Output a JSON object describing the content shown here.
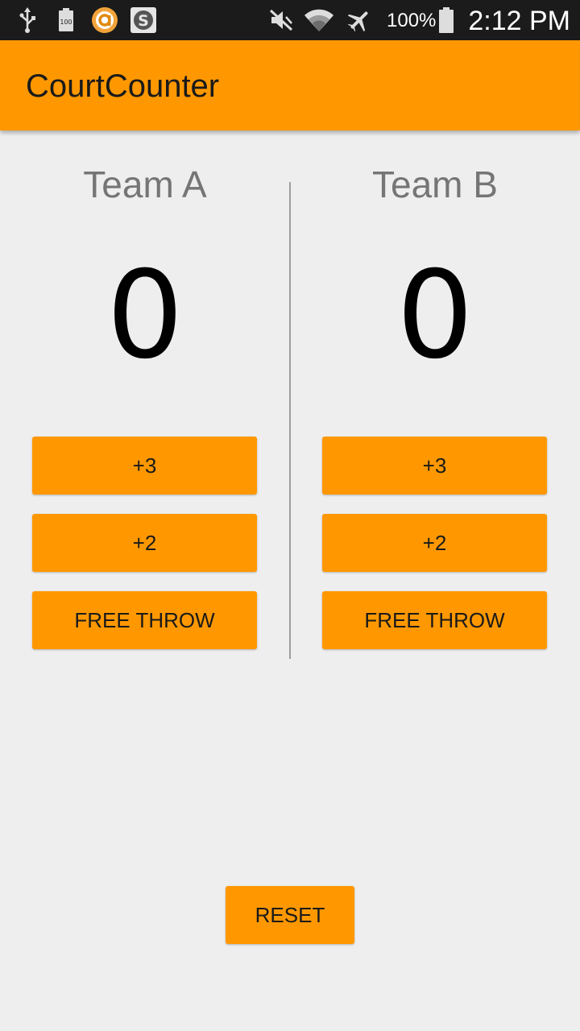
{
  "status_bar": {
    "icons": [
      "usb-icon",
      "battery-100-icon",
      "app-a-icon",
      "app-s-icon",
      "mute-icon",
      "wifi-icon",
      "airplane-icon",
      "battery-icon"
    ],
    "battery_level_text": "100",
    "battery_percent": "100%",
    "time": "2:12 PM"
  },
  "app_bar": {
    "title": "CourtCounter",
    "color": "#ff9800"
  },
  "team_a": {
    "name": "Team A",
    "score": "0",
    "buttons": {
      "plus_three": "+3",
      "plus_two": "+2",
      "free_throw": "FREE THROW"
    }
  },
  "team_b": {
    "name": "Team B",
    "score": "0",
    "buttons": {
      "plus_three": "+3",
      "plus_two": "+2",
      "free_throw": "FREE THROW"
    }
  },
  "reset_label": "RESET",
  "colors": {
    "accent": "#ff9800",
    "background": "#eeeeee",
    "team_name": "#757575",
    "status_bar": "#1b1b1b"
  }
}
